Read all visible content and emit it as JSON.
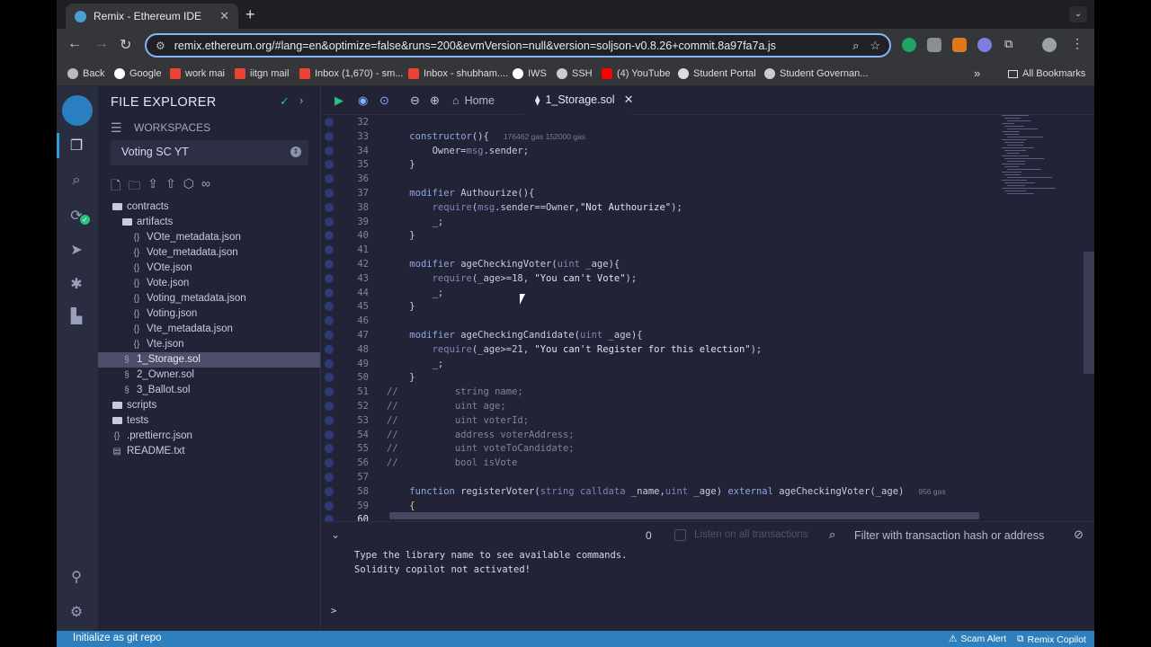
{
  "browser": {
    "tab_title": "Remix - Ethereum IDE",
    "url": "remix.ethereum.org/#lang=en&optimize=false&runs=200&evmVersion=null&version=soljson-v0.8.26+commit.8a97fa7a.js",
    "bookmarks": [
      {
        "label": "Back",
        "color": "#bbbbbb"
      },
      {
        "label": "Google",
        "color": "#ffffff"
      },
      {
        "label": "work mai",
        "color": "#ea4335"
      },
      {
        "label": "iitgn mail",
        "color": "#ea4335"
      },
      {
        "label": "Inbox (1,670) - sm...",
        "color": "#ea4335"
      },
      {
        "label": "Inbox - shubham....",
        "color": "#ea4335"
      },
      {
        "label": "IWS",
        "color": "#ffffff"
      },
      {
        "label": "SSH",
        "color": "#cccccc"
      },
      {
        "label": "(4) YouTube",
        "color": "#ff0000"
      },
      {
        "label": "Student Portal",
        "color": "#dddddd"
      },
      {
        "label": "Student Governan...",
        "color": "#cccccc"
      }
    ],
    "bookmarks_overflow": "»",
    "all_bookmarks": "All Bookmarks"
  },
  "explorer": {
    "title": "FILE EXPLORER",
    "workspaces_label": "WORKSPACES",
    "workspace_name": "Voting SC YT",
    "tree": [
      {
        "label": "contracts",
        "kind": "folder",
        "depth": 0
      },
      {
        "label": "artifacts",
        "kind": "folder",
        "depth": 1
      },
      {
        "label": "VOte_metadata.json",
        "kind": "json",
        "depth": 2
      },
      {
        "label": "Vote_metadata.json",
        "kind": "json",
        "depth": 2
      },
      {
        "label": "VOte.json",
        "kind": "json",
        "depth": 2
      },
      {
        "label": "Vote.json",
        "kind": "json",
        "depth": 2
      },
      {
        "label": "Voting_metadata.json",
        "kind": "json",
        "depth": 2
      },
      {
        "label": "Voting.json",
        "kind": "json",
        "depth": 2
      },
      {
        "label": "Vte_metadata.json",
        "kind": "json",
        "depth": 2
      },
      {
        "label": "Vte.json",
        "kind": "json",
        "depth": 2
      },
      {
        "label": "1_Storage.sol",
        "kind": "sol",
        "depth": 1,
        "selected": true
      },
      {
        "label": "2_Owner.sol",
        "kind": "sol",
        "depth": 1
      },
      {
        "label": "3_Ballot.sol",
        "kind": "sol",
        "depth": 1
      },
      {
        "label": "scripts",
        "kind": "folder",
        "depth": 0
      },
      {
        "label": "tests",
        "kind": "folder",
        "depth": 0
      },
      {
        "label": ".prettierrc.json",
        "kind": "json",
        "depth": 0
      },
      {
        "label": "README.txt",
        "kind": "txt",
        "depth": 0
      }
    ]
  },
  "editor": {
    "home_tab": "Home",
    "file_tab": "1_Storage.sol",
    "lines": [
      {
        "n": "32",
        "parts": []
      },
      {
        "n": "33",
        "parts": [
          [
            "pl",
            "    "
          ],
          [
            "kw",
            "constructor"
          ],
          [
            "pl",
            "(){"
          ]
        ],
        "gas": "176462 gas 152000 gas"
      },
      {
        "n": "34",
        "parts": [
          [
            "pl",
            "        Owner="
          ],
          [
            "ty",
            "msg"
          ],
          [
            "pl",
            ".sender;"
          ]
        ]
      },
      {
        "n": "35",
        "parts": [
          [
            "pl",
            "    }"
          ]
        ]
      },
      {
        "n": "36",
        "parts": []
      },
      {
        "n": "37",
        "parts": [
          [
            "pl",
            "    "
          ],
          [
            "kw",
            "modifier"
          ],
          [
            "pl",
            " Authourize(){"
          ]
        ]
      },
      {
        "n": "38",
        "parts": [
          [
            "pl",
            "        "
          ],
          [
            "ty",
            "require"
          ],
          [
            "pl",
            "("
          ],
          [
            "ty",
            "msg"
          ],
          [
            "pl",
            ".sender==Owner,"
          ],
          [
            "st",
            "\"Not Authourize\""
          ],
          [
            "pl",
            ");"
          ]
        ]
      },
      {
        "n": "39",
        "parts": [
          [
            "pl",
            "        _;"
          ]
        ]
      },
      {
        "n": "40",
        "parts": [
          [
            "pl",
            "    }"
          ]
        ]
      },
      {
        "n": "41",
        "parts": []
      },
      {
        "n": "42",
        "parts": [
          [
            "pl",
            "    "
          ],
          [
            "kw",
            "modifier"
          ],
          [
            "pl",
            " ageCheckingVoter("
          ],
          [
            "ty",
            "uint"
          ],
          [
            "pl",
            " _age){"
          ]
        ]
      },
      {
        "n": "43",
        "parts": [
          [
            "pl",
            "        "
          ],
          [
            "ty",
            "require"
          ],
          [
            "pl",
            "(_age>=18, "
          ],
          [
            "st",
            "\"You can't Vote\""
          ],
          [
            "pl",
            ");"
          ]
        ]
      },
      {
        "n": "44",
        "parts": [
          [
            "pl",
            "        _;"
          ]
        ]
      },
      {
        "n": "45",
        "parts": [
          [
            "pl",
            "    }"
          ]
        ]
      },
      {
        "n": "46",
        "parts": []
      },
      {
        "n": "47",
        "parts": [
          [
            "pl",
            "    "
          ],
          [
            "kw",
            "modifier"
          ],
          [
            "pl",
            " ageCheckingCandidate("
          ],
          [
            "ty",
            "uint"
          ],
          [
            "pl",
            " _age){"
          ]
        ]
      },
      {
        "n": "48",
        "parts": [
          [
            "pl",
            "        "
          ],
          [
            "ty",
            "require"
          ],
          [
            "pl",
            "(_age>=21, "
          ],
          [
            "st",
            "\"You can't Register for this election\""
          ],
          [
            "pl",
            ");"
          ]
        ]
      },
      {
        "n": "49",
        "parts": [
          [
            "pl",
            "        _;"
          ]
        ]
      },
      {
        "n": "50",
        "parts": [
          [
            "pl",
            "    }"
          ]
        ]
      },
      {
        "n": "51",
        "parts": [
          [
            "cm",
            "//          string name;"
          ]
        ]
      },
      {
        "n": "52",
        "parts": [
          [
            "cm",
            "//          uint age;"
          ]
        ]
      },
      {
        "n": "53",
        "parts": [
          [
            "cm",
            "//          uint voterId;"
          ]
        ]
      },
      {
        "n": "54",
        "parts": [
          [
            "cm",
            "//          address voterAddress;"
          ]
        ]
      },
      {
        "n": "55",
        "parts": [
          [
            "cm",
            "//          uint voteToCandidate;"
          ]
        ]
      },
      {
        "n": "56",
        "parts": [
          [
            "cm",
            "//          bool isVote"
          ]
        ]
      },
      {
        "n": "57",
        "parts": []
      },
      {
        "n": "58",
        "parts": [
          [
            "pl",
            "    "
          ],
          [
            "kw",
            "function"
          ],
          [
            "pl",
            " registerVoter("
          ],
          [
            "ty",
            "string calldata"
          ],
          [
            "pl",
            " _name,"
          ],
          [
            "ty",
            "uint"
          ],
          [
            "pl",
            " _age) "
          ],
          [
            "kw",
            "external"
          ],
          [
            "pl",
            " ageCheckingVoter(_age)"
          ]
        ],
        "gas": "956 gas"
      },
      {
        "n": "59",
        "parts": [
          [
            "pn",
            "    {"
          ]
        ]
      },
      {
        "n": "60",
        "parts": [],
        "current": true
      }
    ]
  },
  "terminal": {
    "count": "0",
    "listen_label": "Listen on all transactions",
    "filter_placeholder": "Filter with transaction hash or address",
    "lines": [
      "Type the library name to see available commands.",
      "Solidity copilot not activated!"
    ],
    "prompt": ">"
  },
  "statusbar": {
    "left": "Initialize as git repo",
    "scam_alert": "Scam Alert",
    "copilot": "Remix Copilot"
  },
  "colors": {
    "accent": "#2e7fbd",
    "panel": "#222336",
    "selected_row": "#4d4f6a"
  }
}
